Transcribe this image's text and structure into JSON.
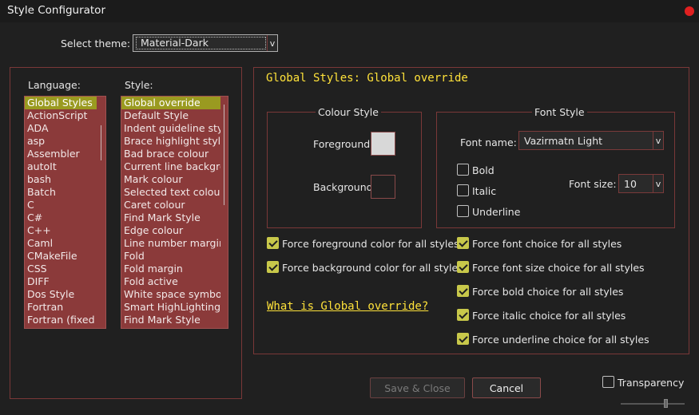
{
  "window": {
    "title": "Style Configurator"
  },
  "theme": {
    "label": "Select theme:",
    "value": "Material-Dark"
  },
  "language": {
    "label": "Language:",
    "items": [
      "Global Styles",
      "ActionScript",
      "ADA",
      "asp",
      "Assembler",
      "autoIt",
      "bash",
      "Batch",
      "C",
      "C#",
      "C++",
      "Caml",
      "CMakeFile",
      "CSS",
      "DIFF",
      "Dos Style",
      "Fortran",
      "Fortran (fixed f"
    ]
  },
  "style": {
    "label": "Style:",
    "items": [
      "Global override",
      "Default Style",
      "Indent guideline style",
      "Brace highlight style",
      "Bad brace colour",
      "Current line backgrou",
      "Mark colour",
      "Selected text colour",
      "Caret colour",
      "Find Mark Style",
      "Edge colour",
      "Line number margin",
      "Fold",
      "Fold margin",
      "Fold active",
      "White space symbol",
      "Smart HighLighting",
      "Find Mark Style"
    ]
  },
  "header": "Global Styles: Global override",
  "colour_style": {
    "title": "Colour Style",
    "foreground_label": "Foreground",
    "background_label": "Background",
    "foreground_color": "#d8d8d8",
    "background_color": "#202020"
  },
  "font_style": {
    "title": "Font Style",
    "name_label": "Font name:",
    "name_value": "Vazirmatn Light",
    "bold_label": "Bold",
    "italic_label": "Italic",
    "underline_label": "Underline",
    "size_label": "Font size:",
    "size_value": "10"
  },
  "force_options": {
    "left": [
      "Force foreground color for all styles",
      "Force background color for all styles"
    ],
    "right": [
      "Force font choice for all styles",
      "Force font size choice for all styles",
      "Force bold choice for all styles",
      "Force italic choice for all styles",
      "Force underline choice for all styles"
    ]
  },
  "help_link": "What is Global override?",
  "buttons": {
    "save": "Save & Close",
    "cancel": "Cancel"
  },
  "transparency": {
    "label": "Transparency"
  },
  "colors": {
    "accent": "#ffe23a",
    "list_bg": "#8b3a3a",
    "selection": "#9a9a20",
    "border": "#7a3838"
  }
}
